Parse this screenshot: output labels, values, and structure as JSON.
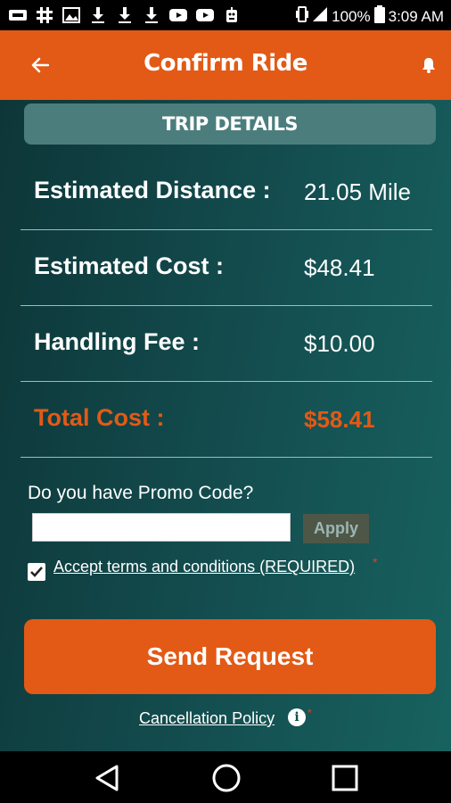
{
  "status_bar": {
    "icons_left": [
      "usb-icon",
      "slack-icon",
      "image-icon",
      "download-icon",
      "download-icon",
      "download-icon",
      "youtube-icon",
      "youtube-icon",
      "robot-icon"
    ],
    "battery_percent": "100%",
    "time": "3:09 AM"
  },
  "app_bar": {
    "title": "Confirm Ride",
    "color": "#E25A16"
  },
  "trip": {
    "header": "TRIP DETAILS",
    "rows": [
      {
        "label": "Estimated Distance :",
        "value": "21.05 Mile"
      },
      {
        "label": "Estimated Cost :",
        "value": "$48.41"
      },
      {
        "label": "Handling Fee :",
        "value": "$10.00"
      },
      {
        "label": "Total Cost :",
        "value": "$58.41"
      }
    ]
  },
  "promo": {
    "label": "Do you have Promo Code?",
    "value": "",
    "placeholder": "",
    "apply_label": "Apply"
  },
  "terms": {
    "checked": true,
    "label": "Accept terms and conditions (REQUIRED)",
    "required_mark": "*"
  },
  "send_button": "Send Request",
  "cancellation": {
    "label": "Cancellation Policy",
    "info_glyph": "i",
    "required_mark": "*"
  }
}
